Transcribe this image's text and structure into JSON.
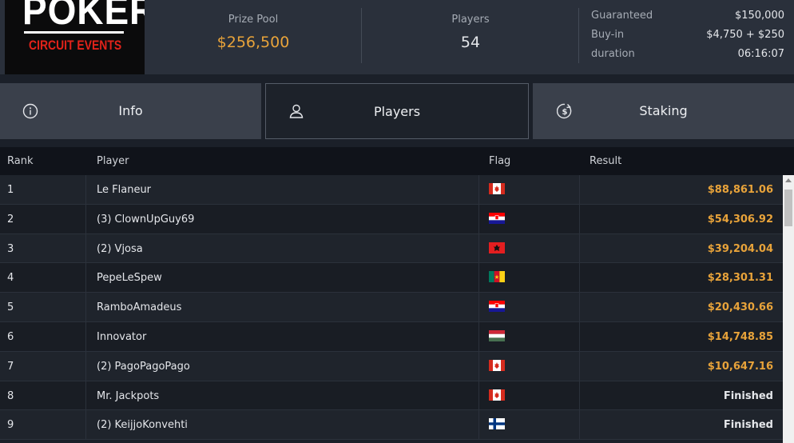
{
  "header": {
    "logo_main": "POKER",
    "logo_sub": "CIRCUIT EVENTS",
    "prize_pool_label": "Prize Pool",
    "prize_pool_value": "$256,500",
    "players_label": "Players",
    "players_value": "54",
    "meta": [
      {
        "key": "Guaranteed",
        "value": "$150,000"
      },
      {
        "key": "Buy-in",
        "value": "$4,750 + $250"
      },
      {
        "key": "duration",
        "value": "06:16:07"
      }
    ]
  },
  "tabs": [
    {
      "label": "Info",
      "icon": "info-icon"
    },
    {
      "label": "Players",
      "icon": "user-icon",
      "active": true
    },
    {
      "label": "Staking",
      "icon": "dollar-circle-icon"
    }
  ],
  "table": {
    "columns": [
      "Rank",
      "Player",
      "Flag",
      "Result"
    ],
    "rows": [
      {
        "rank": "1",
        "player": "Le Flaneur",
        "flag": "canada",
        "result": "$88,861.06"
      },
      {
        "rank": "2",
        "player": "(3) ClownUpGuy69",
        "flag": "croatia",
        "result": "$54,306.92"
      },
      {
        "rank": "3",
        "player": "(2) Vjosa",
        "flag": "albania",
        "result": "$39,204.04"
      },
      {
        "rank": "4",
        "player": "PepeLeSpew",
        "flag": "cameroon",
        "result": "$28,301.31"
      },
      {
        "rank": "5",
        "player": "RamboAmadeus",
        "flag": "croatia",
        "result": "$20,430.66"
      },
      {
        "rank": "6",
        "player": "Innovator",
        "flag": "hungary",
        "result": "$14,748.85"
      },
      {
        "rank": "7",
        "player": "(2) PagoPagoPago",
        "flag": "canada",
        "result": "$10,647.16"
      },
      {
        "rank": "8",
        "player": "Mr. Jackpots",
        "flag": "canada",
        "result": "Finished"
      },
      {
        "rank": "9",
        "player": "(2) KeijjoKonvehti",
        "flag": "finland",
        "result": "Finished"
      }
    ]
  },
  "colors": {
    "accent_gold": "#e8a33a",
    "logo_red": "#e2231a",
    "header_bg": "#2a303b"
  }
}
